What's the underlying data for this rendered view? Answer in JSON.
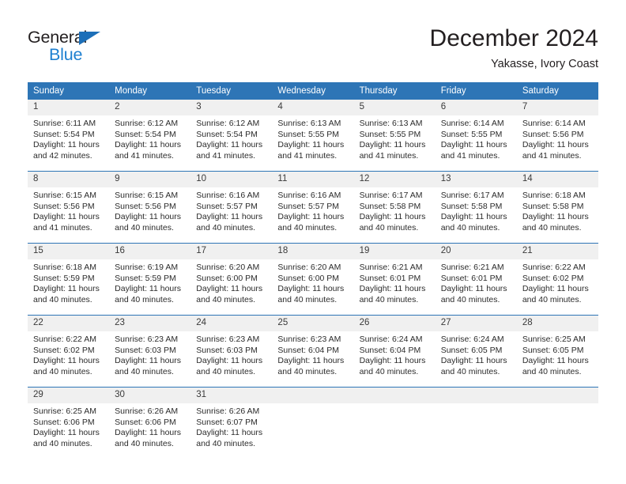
{
  "brand": {
    "name_part1": "General",
    "name_part2": "Blue",
    "triangle_icon": "blue-triangle-icon",
    "color_dark": "#231f20",
    "color_blue": "#1d7fd0"
  },
  "header": {
    "title": "December 2024",
    "subtitle": "Yakasse, Ivory Coast"
  },
  "theme": {
    "header_blue": "#2e75b6",
    "daynum_band": "#f0f0f0",
    "text": "#2b2b2b"
  },
  "calendar": {
    "weekday_headers": [
      "Sunday",
      "Monday",
      "Tuesday",
      "Wednesday",
      "Thursday",
      "Friday",
      "Saturday"
    ],
    "weeks": [
      [
        {
          "day": "1",
          "sunrise": "Sunrise: 6:11 AM",
          "sunset": "Sunset: 5:54 PM",
          "daylight_line1": "Daylight: 11 hours",
          "daylight_line2": "and 42 minutes."
        },
        {
          "day": "2",
          "sunrise": "Sunrise: 6:12 AM",
          "sunset": "Sunset: 5:54 PM",
          "daylight_line1": "Daylight: 11 hours",
          "daylight_line2": "and 41 minutes."
        },
        {
          "day": "3",
          "sunrise": "Sunrise: 6:12 AM",
          "sunset": "Sunset: 5:54 PM",
          "daylight_line1": "Daylight: 11 hours",
          "daylight_line2": "and 41 minutes."
        },
        {
          "day": "4",
          "sunrise": "Sunrise: 6:13 AM",
          "sunset": "Sunset: 5:55 PM",
          "daylight_line1": "Daylight: 11 hours",
          "daylight_line2": "and 41 minutes."
        },
        {
          "day": "5",
          "sunrise": "Sunrise: 6:13 AM",
          "sunset": "Sunset: 5:55 PM",
          "daylight_line1": "Daylight: 11 hours",
          "daylight_line2": "and 41 minutes."
        },
        {
          "day": "6",
          "sunrise": "Sunrise: 6:14 AM",
          "sunset": "Sunset: 5:55 PM",
          "daylight_line1": "Daylight: 11 hours",
          "daylight_line2": "and 41 minutes."
        },
        {
          "day": "7",
          "sunrise": "Sunrise: 6:14 AM",
          "sunset": "Sunset: 5:56 PM",
          "daylight_line1": "Daylight: 11 hours",
          "daylight_line2": "and 41 minutes."
        }
      ],
      [
        {
          "day": "8",
          "sunrise": "Sunrise: 6:15 AM",
          "sunset": "Sunset: 5:56 PM",
          "daylight_line1": "Daylight: 11 hours",
          "daylight_line2": "and 41 minutes."
        },
        {
          "day": "9",
          "sunrise": "Sunrise: 6:15 AM",
          "sunset": "Sunset: 5:56 PM",
          "daylight_line1": "Daylight: 11 hours",
          "daylight_line2": "and 40 minutes."
        },
        {
          "day": "10",
          "sunrise": "Sunrise: 6:16 AM",
          "sunset": "Sunset: 5:57 PM",
          "daylight_line1": "Daylight: 11 hours",
          "daylight_line2": "and 40 minutes."
        },
        {
          "day": "11",
          "sunrise": "Sunrise: 6:16 AM",
          "sunset": "Sunset: 5:57 PM",
          "daylight_line1": "Daylight: 11 hours",
          "daylight_line2": "and 40 minutes."
        },
        {
          "day": "12",
          "sunrise": "Sunrise: 6:17 AM",
          "sunset": "Sunset: 5:58 PM",
          "daylight_line1": "Daylight: 11 hours",
          "daylight_line2": "and 40 minutes."
        },
        {
          "day": "13",
          "sunrise": "Sunrise: 6:17 AM",
          "sunset": "Sunset: 5:58 PM",
          "daylight_line1": "Daylight: 11 hours",
          "daylight_line2": "and 40 minutes."
        },
        {
          "day": "14",
          "sunrise": "Sunrise: 6:18 AM",
          "sunset": "Sunset: 5:58 PM",
          "daylight_line1": "Daylight: 11 hours",
          "daylight_line2": "and 40 minutes."
        }
      ],
      [
        {
          "day": "15",
          "sunrise": "Sunrise: 6:18 AM",
          "sunset": "Sunset: 5:59 PM",
          "daylight_line1": "Daylight: 11 hours",
          "daylight_line2": "and 40 minutes."
        },
        {
          "day": "16",
          "sunrise": "Sunrise: 6:19 AM",
          "sunset": "Sunset: 5:59 PM",
          "daylight_line1": "Daylight: 11 hours",
          "daylight_line2": "and 40 minutes."
        },
        {
          "day": "17",
          "sunrise": "Sunrise: 6:20 AM",
          "sunset": "Sunset: 6:00 PM",
          "daylight_line1": "Daylight: 11 hours",
          "daylight_line2": "and 40 minutes."
        },
        {
          "day": "18",
          "sunrise": "Sunrise: 6:20 AM",
          "sunset": "Sunset: 6:00 PM",
          "daylight_line1": "Daylight: 11 hours",
          "daylight_line2": "and 40 minutes."
        },
        {
          "day": "19",
          "sunrise": "Sunrise: 6:21 AM",
          "sunset": "Sunset: 6:01 PM",
          "daylight_line1": "Daylight: 11 hours",
          "daylight_line2": "and 40 minutes."
        },
        {
          "day": "20",
          "sunrise": "Sunrise: 6:21 AM",
          "sunset": "Sunset: 6:01 PM",
          "daylight_line1": "Daylight: 11 hours",
          "daylight_line2": "and 40 minutes."
        },
        {
          "day": "21",
          "sunrise": "Sunrise: 6:22 AM",
          "sunset": "Sunset: 6:02 PM",
          "daylight_line1": "Daylight: 11 hours",
          "daylight_line2": "and 40 minutes."
        }
      ],
      [
        {
          "day": "22",
          "sunrise": "Sunrise: 6:22 AM",
          "sunset": "Sunset: 6:02 PM",
          "daylight_line1": "Daylight: 11 hours",
          "daylight_line2": "and 40 minutes."
        },
        {
          "day": "23",
          "sunrise": "Sunrise: 6:23 AM",
          "sunset": "Sunset: 6:03 PM",
          "daylight_line1": "Daylight: 11 hours",
          "daylight_line2": "and 40 minutes."
        },
        {
          "day": "24",
          "sunrise": "Sunrise: 6:23 AM",
          "sunset": "Sunset: 6:03 PM",
          "daylight_line1": "Daylight: 11 hours",
          "daylight_line2": "and 40 minutes."
        },
        {
          "day": "25",
          "sunrise": "Sunrise: 6:23 AM",
          "sunset": "Sunset: 6:04 PM",
          "daylight_line1": "Daylight: 11 hours",
          "daylight_line2": "and 40 minutes."
        },
        {
          "day": "26",
          "sunrise": "Sunrise: 6:24 AM",
          "sunset": "Sunset: 6:04 PM",
          "daylight_line1": "Daylight: 11 hours",
          "daylight_line2": "and 40 minutes."
        },
        {
          "day": "27",
          "sunrise": "Sunrise: 6:24 AM",
          "sunset": "Sunset: 6:05 PM",
          "daylight_line1": "Daylight: 11 hours",
          "daylight_line2": "and 40 minutes."
        },
        {
          "day": "28",
          "sunrise": "Sunrise: 6:25 AM",
          "sunset": "Sunset: 6:05 PM",
          "daylight_line1": "Daylight: 11 hours",
          "daylight_line2": "and 40 minutes."
        }
      ],
      [
        {
          "day": "29",
          "sunrise": "Sunrise: 6:25 AM",
          "sunset": "Sunset: 6:06 PM",
          "daylight_line1": "Daylight: 11 hours",
          "daylight_line2": "and 40 minutes."
        },
        {
          "day": "30",
          "sunrise": "Sunrise: 6:26 AM",
          "sunset": "Sunset: 6:06 PM",
          "daylight_line1": "Daylight: 11 hours",
          "daylight_line2": "and 40 minutes."
        },
        {
          "day": "31",
          "sunrise": "Sunrise: 6:26 AM",
          "sunset": "Sunset: 6:07 PM",
          "daylight_line1": "Daylight: 11 hours",
          "daylight_line2": "and 40 minutes."
        },
        {
          "day": "",
          "sunrise": "",
          "sunset": "",
          "daylight_line1": "",
          "daylight_line2": ""
        },
        {
          "day": "",
          "sunrise": "",
          "sunset": "",
          "daylight_line1": "",
          "daylight_line2": ""
        },
        {
          "day": "",
          "sunrise": "",
          "sunset": "",
          "daylight_line1": "",
          "daylight_line2": ""
        },
        {
          "day": "",
          "sunrise": "",
          "sunset": "",
          "daylight_line1": "",
          "daylight_line2": ""
        }
      ]
    ]
  }
}
